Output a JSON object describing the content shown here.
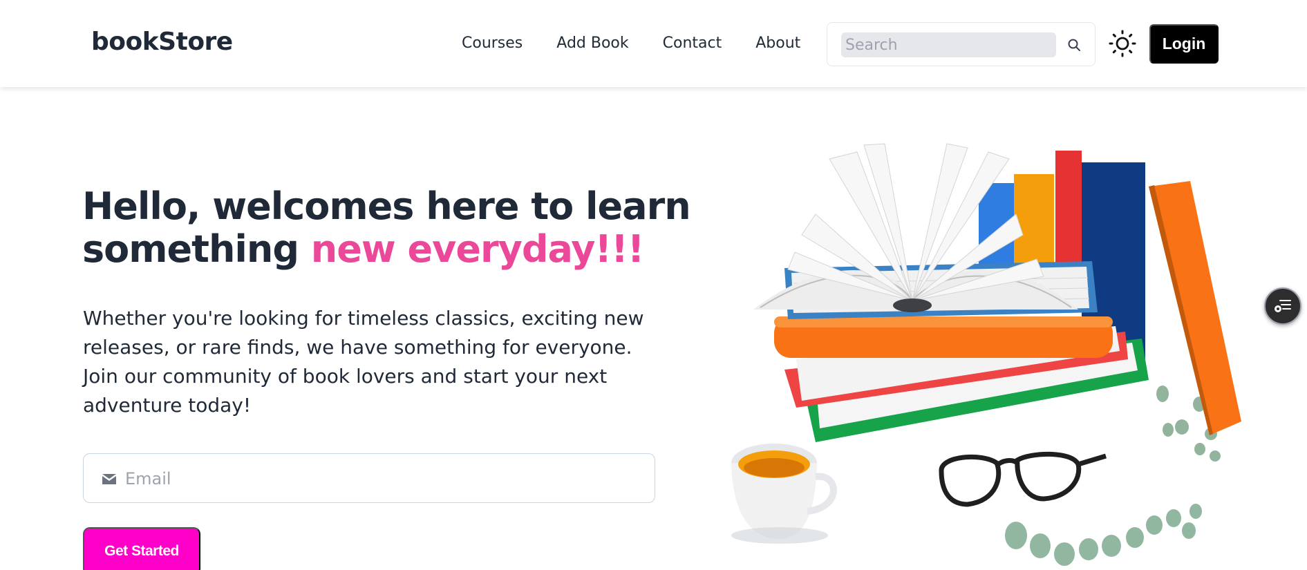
{
  "header": {
    "logo": "bookStore",
    "nav": [
      "Courses",
      "Add Book",
      "Contact",
      "About"
    ],
    "search": {
      "placeholder": "Search",
      "icon": "search-icon"
    },
    "theme_icon": "sun-icon",
    "login_label": "Login"
  },
  "hero": {
    "title_part1": "Hello, welcomes here to learn something ",
    "title_accent": "new everyday!!!",
    "description": "Whether you're looking for timeless classics, exciting new releases, or rare finds, we have something for everyone. Join our community of book lovers and start your next adventure today!",
    "email": {
      "placeholder": "Email",
      "icon": "mail-icon"
    },
    "cta_label": "Get Started",
    "illustration": "books-illustration"
  },
  "floating_button": {
    "icon": "settings-list-icon"
  },
  "colors": {
    "accent": "#ec4899",
    "cta": "#ff00c8",
    "login_bg": "#000000",
    "text": "#1f2937"
  }
}
